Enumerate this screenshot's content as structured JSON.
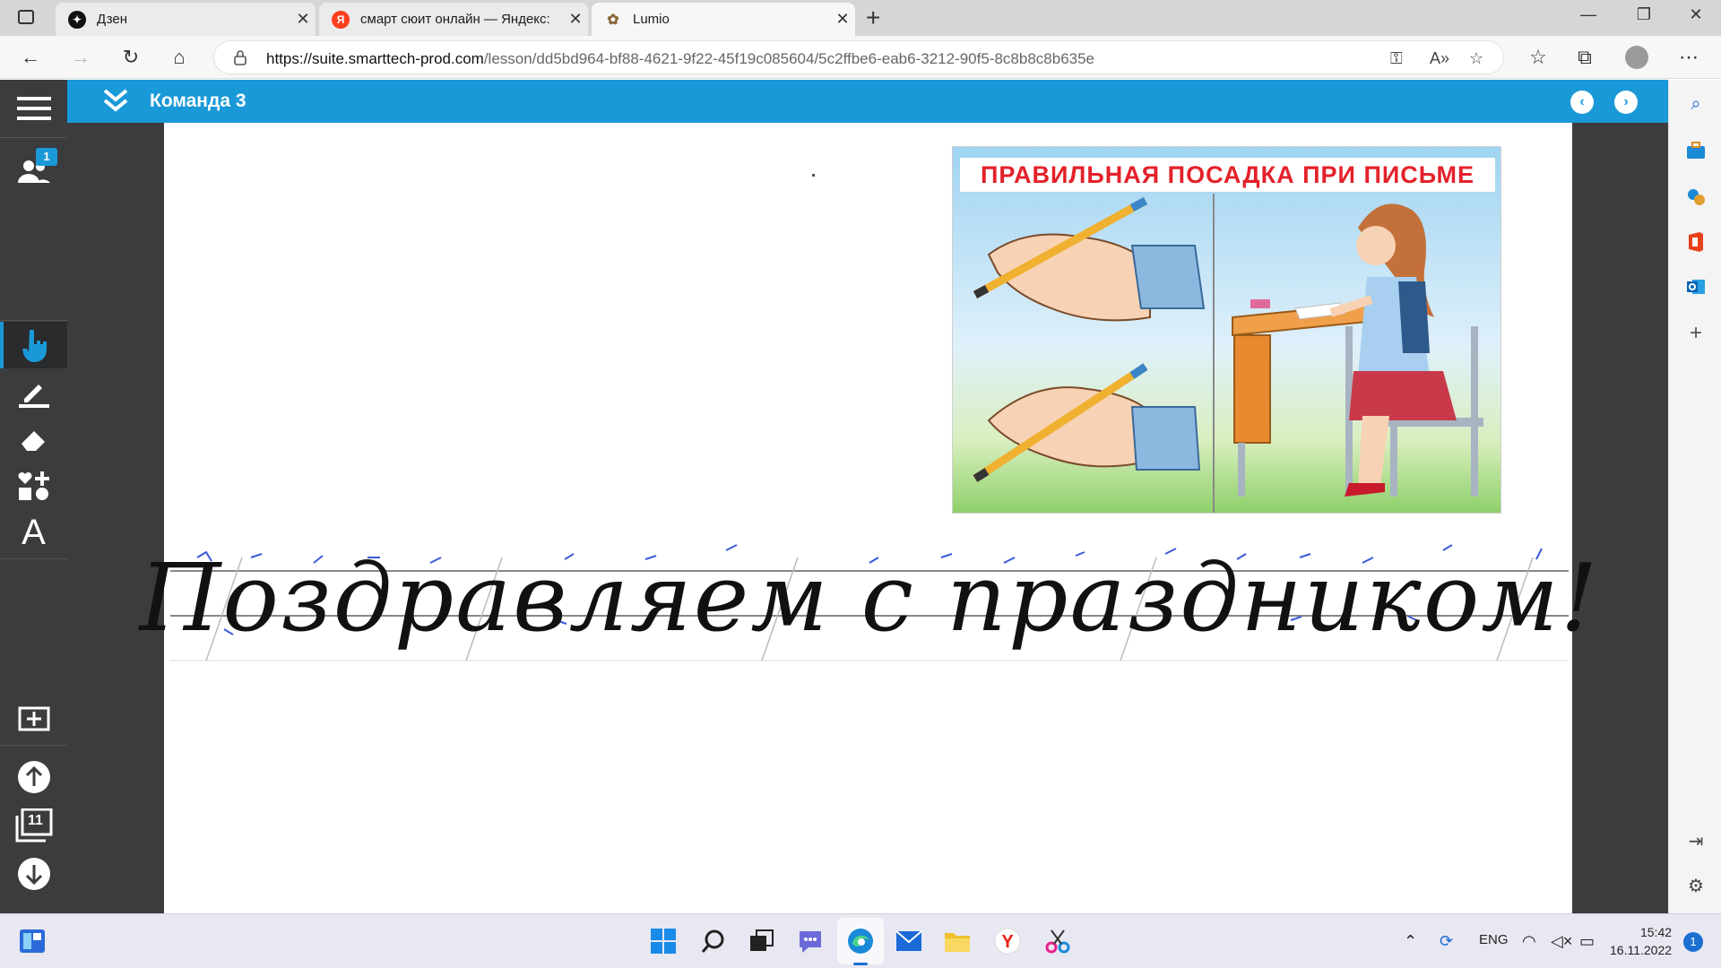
{
  "browser": {
    "tabs": [
      {
        "title": "Дзен",
        "favicon": "dzen-icon",
        "active": false
      },
      {
        "title": "смарт сюит онлайн — Яндекс:",
        "favicon": "yandex-icon",
        "active": false
      },
      {
        "title": "Lumio",
        "favicon": "lumio-icon",
        "active": true
      }
    ],
    "url_host": "https://suite.smarttech-prod.com",
    "url_path": "/lesson/dd5bd964-bf88-4621-9f22-45f19c085604/5c2ffbe6-eab6-3212-90f5-8c8b8c8b635e"
  },
  "lumio": {
    "team_title": "Команда 3",
    "participants_badge": "1",
    "page_count": "11"
  },
  "poster": {
    "title": "ПРАВИЛЬНАЯ ПОСАДКА ПРИ ПИСЬМЕ"
  },
  "handwriting": {
    "text": "Поздравляем с праздником!"
  },
  "taskbar": {
    "language": "ENG",
    "time": "15:42",
    "date": "16.11.2022",
    "notifications": "1"
  },
  "colors": {
    "accent": "#1a99d8",
    "toolbar_dark": "#3b3c3e",
    "poster_title_red": "#e4212a"
  }
}
